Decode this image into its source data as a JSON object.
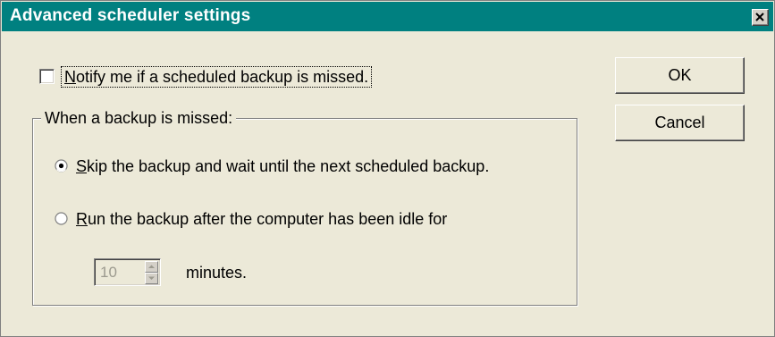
{
  "window": {
    "title": "Advanced scheduler settings",
    "titlebar_color": "#008080",
    "face_color": "#ece9d8"
  },
  "notify": {
    "checked": false,
    "label_mnemonic": "N",
    "label_rest": "otify me if a scheduled backup is missed."
  },
  "missed_group": {
    "legend": "When a backup is missed:",
    "options": [
      {
        "selected": true,
        "label_mnemonic": "S",
        "label_rest": "kip the backup and wait until the next scheduled backup."
      },
      {
        "selected": false,
        "label_mnemonic": "R",
        "label_rest": "un the backup after the computer has been idle for"
      }
    ],
    "idle_minutes": {
      "value": "10",
      "enabled": false,
      "unit_label": "minutes."
    }
  },
  "buttons": {
    "ok": "OK",
    "cancel": "Cancel"
  },
  "icons": {
    "close": "close-icon",
    "spin_up": "arrow-up-icon",
    "spin_down": "arrow-down-icon"
  }
}
